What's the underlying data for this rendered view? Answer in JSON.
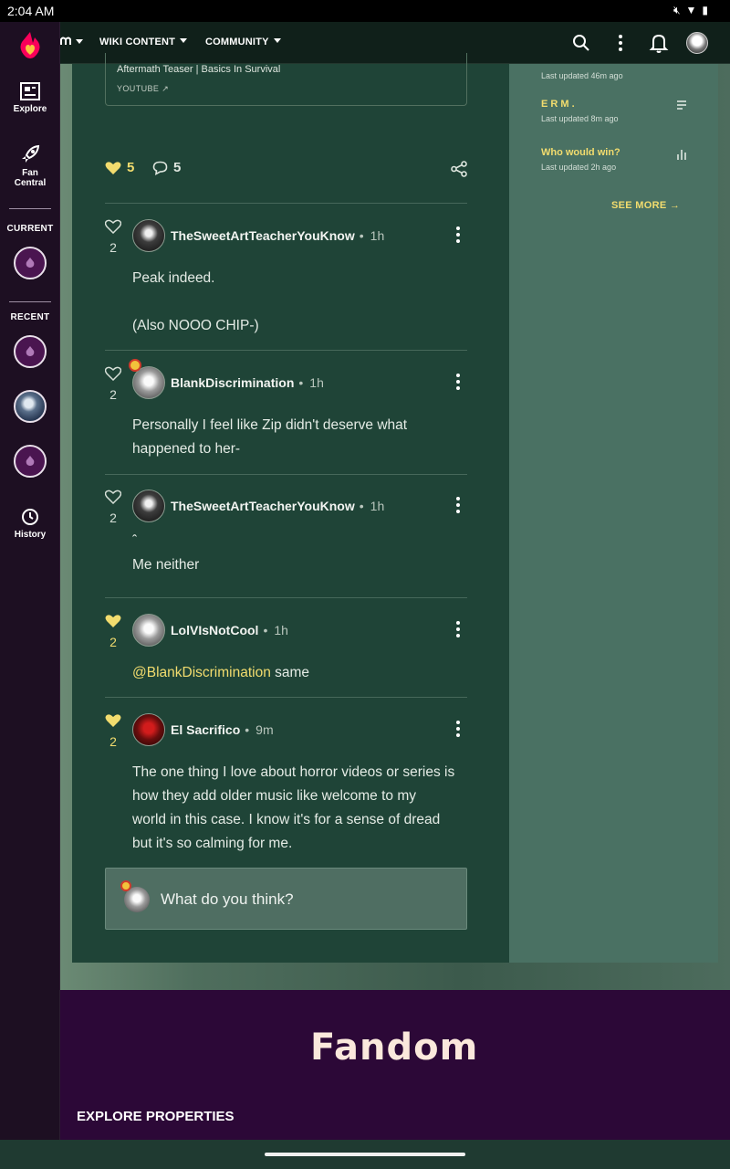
{
  "status_bar": {
    "time": "2:04 AM"
  },
  "rail": {
    "explore_label": "Explore",
    "fan_central_label_1": "Fan",
    "fan_central_label_2": "Central",
    "current_label": "CURRENT",
    "recent_label": "RECENT",
    "history_label": "History"
  },
  "topnav": {
    "wiki_content": "WIKI CONTENT",
    "community": "COMMUNITY"
  },
  "embed": {
    "title": "Aftermath Teaser | Basics In Survival",
    "source": "YOUTUBE"
  },
  "post": {
    "likes": "5",
    "comments": "5"
  },
  "comments": [
    {
      "user": "TheSweetArtTeacherYouKnow",
      "time": "1h",
      "likes": "2",
      "line1": "Peak indeed.",
      "line2": "(Also NOOO CHIP-)"
    },
    {
      "user": "BlankDiscrimination",
      "time": "1h",
      "likes": "2",
      "line1": "Personally I feel like Zip didn't deserve what",
      "line2": "happened to her-"
    },
    {
      "user": "TheSweetArtTeacherYouKnow",
      "time": "1h",
      "likes": "2",
      "line1": "ˆ",
      "line2": "Me neither"
    },
    {
      "user": "LolVIsNotCool",
      "time": "1h",
      "likes": "2",
      "mention": "@BlankDiscrimination",
      "text": " same"
    },
    {
      "user": "El Sacrifico",
      "time": "9m",
      "likes": "2",
      "lines": [
        "The one thing I love about horror videos or series is",
        "how they add older music like welcome to my",
        "world in this case. I know it's for a sense of dread",
        "but it's so calming for me."
      ]
    }
  ],
  "composer": {
    "placeholder": "What do you think?"
  },
  "side": {
    "entry0_meta": "Last updated 46m ago",
    "entry1_title": "E R M .",
    "entry1_meta": "Last updated 8m ago",
    "entry2_title": "Who would win?",
    "entry2_meta": "Last updated 2h ago",
    "see_more": "SEE MORE"
  },
  "footer": {
    "logo": "Fandom",
    "explore": "EXPLORE PROPERTIES"
  },
  "colors": {
    "accent": "#f2dc6e",
    "brand": "#fa005a",
    "footer_bg": "#2c0837"
  }
}
